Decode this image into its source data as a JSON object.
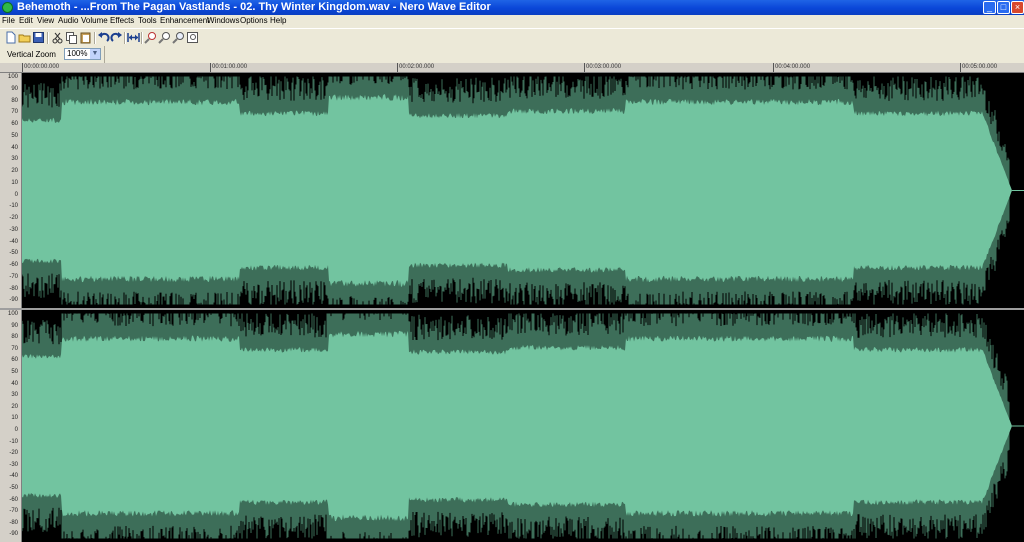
{
  "window": {
    "title": "Behemoth - ...From The Pagan Vastlands - 02. Thy Winter Kingdom.wav - Nero Wave Editor",
    "controls": [
      "_",
      "□",
      "×"
    ]
  },
  "menu": {
    "items": [
      "File",
      "Edit",
      "View",
      "Audio",
      "Volume",
      "Effects",
      "Tools",
      "Enhancement",
      "Windows",
      "Options",
      "Help"
    ]
  },
  "toolbar": {
    "icons": [
      "new-file-icon",
      "open-folder-icon",
      "save-disk-icon",
      "cut-scissors-icon",
      "copy-icon",
      "paste-icon",
      "undo-icon",
      "redo-icon",
      "fit-width-icon",
      "zoom-in-icon",
      "zoom-out-icon",
      "zoom-selection-icon",
      "zoom-full-icon"
    ]
  },
  "zoom": {
    "label": "Vertical Zoom",
    "value": "100%"
  },
  "timeline": {
    "marks": [
      "00:00:00.000",
      "00:01:00.000",
      "00:02:00.000",
      "00:03:00.000",
      "00:04:00.000",
      "00:05:00.000"
    ]
  },
  "amplitude_axis": {
    "labels": [
      "100",
      "90",
      "80",
      "70",
      "60",
      "50",
      "40",
      "30",
      "20",
      "10",
      "0",
      "-10",
      "-20",
      "-30",
      "-40",
      "-50",
      "-60",
      "-70",
      "-80",
      "-90"
    ]
  },
  "colors": {
    "waveform": "#72c4a0",
    "waveform_dark": "#3d6e59",
    "background": "#000000"
  }
}
